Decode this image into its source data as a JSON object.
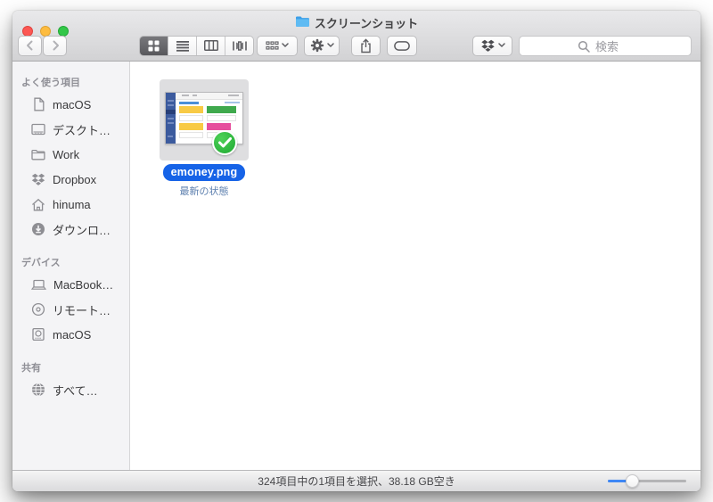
{
  "window": {
    "title": "スクリーンショット"
  },
  "toolbar": {
    "search_placeholder": "検索",
    "buttons": [
      "back",
      "forward",
      "view-grid",
      "view-list",
      "view-columns",
      "view-coverflow",
      "arrange",
      "actions-gear",
      "share",
      "tags",
      "dropbox"
    ]
  },
  "sidebar": {
    "sections": [
      {
        "header": "よく使う項目",
        "items": [
          {
            "label": "macOS",
            "icon": "document-icon"
          },
          {
            "label": "デスクト…",
            "icon": "desktop-icon"
          },
          {
            "label": "Work",
            "icon": "folder-icon"
          },
          {
            "label": "Dropbox",
            "icon": "dropbox-icon"
          },
          {
            "label": "hinuma",
            "icon": "home-icon"
          },
          {
            "label": "ダウンロ…",
            "icon": "downloads-icon"
          }
        ]
      },
      {
        "header": "デバイス",
        "items": [
          {
            "label": "MacBook…",
            "icon": "laptop-icon"
          },
          {
            "label": "リモート…",
            "icon": "disc-icon"
          },
          {
            "label": "macOS",
            "icon": "drive-icon"
          }
        ]
      },
      {
        "header": "共有",
        "items": [
          {
            "label": "すべて…",
            "icon": "globe-icon"
          }
        ]
      }
    ]
  },
  "content": {
    "file": {
      "name": "emoney.png",
      "status": "最新の状態",
      "badge": "dropbox-synced"
    }
  },
  "statusbar": {
    "text": "324項目中の1項目を選択、38.18 GB空き",
    "icon_size_slider_pct": 32
  },
  "colors": {
    "selection_blue": "#1663e7",
    "status_text_blue": "#5c7fae",
    "badge_green": "#2fb83d",
    "traffic_red": "#fc5753",
    "traffic_yellow": "#fdbc40",
    "traffic_green": "#33c748"
  }
}
